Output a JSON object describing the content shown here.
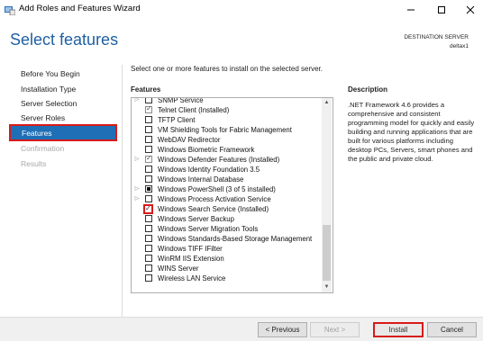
{
  "window": {
    "title": "Add Roles and Features Wizard",
    "controls": {
      "minimize": "─",
      "maximize": "☐",
      "close": "✕"
    }
  },
  "header": {
    "page_title": "Select features",
    "destination_label": "DESTINATION SERVER",
    "destination_server": "deltax1"
  },
  "nav": {
    "items": [
      {
        "label": "Before You Begin"
      },
      {
        "label": "Installation Type"
      },
      {
        "label": "Server Selection"
      },
      {
        "label": "Server Roles"
      },
      {
        "label": "Features"
      },
      {
        "label": "Confirmation"
      },
      {
        "label": "Results"
      }
    ],
    "active_index": 4
  },
  "main": {
    "instruction": "Select one or more features to install on the selected server.",
    "features_heading": "Features",
    "features": [
      {
        "label": "SNMP Service",
        "expand": true,
        "state": "unchecked"
      },
      {
        "label": "Telnet Client (Installed)",
        "expand": false,
        "state": "checked-gray"
      },
      {
        "label": "TFTP Client",
        "expand": false,
        "state": "unchecked"
      },
      {
        "label": "VM Shielding Tools for Fabric Management",
        "expand": false,
        "state": "unchecked"
      },
      {
        "label": "WebDAV Redirector",
        "expand": false,
        "state": "unchecked"
      },
      {
        "label": "Windows Biometric Framework",
        "expand": false,
        "state": "unchecked"
      },
      {
        "label": "Windows Defender Features (Installed)",
        "expand": true,
        "state": "checked-gray"
      },
      {
        "label": "Windows Identity Foundation 3.5",
        "expand": false,
        "state": "unchecked"
      },
      {
        "label": "Windows Internal Database",
        "expand": false,
        "state": "unchecked"
      },
      {
        "label": "Windows PowerShell (3 of 5 installed)",
        "expand": true,
        "state": "partial"
      },
      {
        "label": "Windows Process Activation Service",
        "expand": true,
        "state": "unchecked"
      },
      {
        "label": "Windows Search Service (Installed)",
        "expand": false,
        "state": "checked-highlight"
      },
      {
        "label": "Windows Server Backup",
        "expand": false,
        "state": "unchecked"
      },
      {
        "label": "Windows Server Migration Tools",
        "expand": false,
        "state": "unchecked"
      },
      {
        "label": "Windows Standards-Based Storage Management",
        "expand": false,
        "state": "unchecked"
      },
      {
        "label": "Windows TIFF IFilter",
        "expand": false,
        "state": "unchecked"
      },
      {
        "label": "WinRM IIS Extension",
        "expand": false,
        "state": "unchecked"
      },
      {
        "label": "WINS Server",
        "expand": false,
        "state": "unchecked"
      },
      {
        "label": "Wireless LAN Service",
        "expand": false,
        "state": "unchecked"
      }
    ],
    "description_heading": "Description",
    "description_text": ".NET Framework 4.6 provides a comprehensive and consistent programming model for quickly and easily building and running applications that are built for various platforms including desktop PCs, Servers, smart phones and the public and private cloud."
  },
  "footer": {
    "previous": "< Previous",
    "next": "Next >",
    "install": "Install",
    "cancel": "Cancel"
  },
  "colors": {
    "accent": "#1f6fb6",
    "title_blue": "#1f5fa4",
    "highlight_red": "#d81a1a"
  }
}
